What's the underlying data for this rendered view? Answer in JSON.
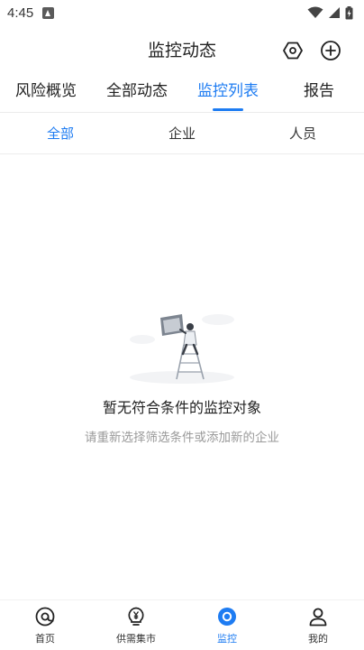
{
  "status_bar": {
    "time": "4:45"
  },
  "header": {
    "title": "监控动态"
  },
  "main_tabs": [
    {
      "label": "风险概览"
    },
    {
      "label": "全部动态"
    },
    {
      "label": "监控列表"
    },
    {
      "label": "报告"
    }
  ],
  "active_main_tab": "监控列表",
  "sub_tabs": [
    {
      "label": "全部"
    },
    {
      "label": "企业"
    },
    {
      "label": "人员"
    }
  ],
  "active_sub_tab": "全部",
  "empty_state": {
    "title": "暂无符合条件的监控对象",
    "subtitle": "请重新选择筛选条件或添加新的企业"
  },
  "bottom_nav": [
    {
      "label": "首页",
      "icon": "home-at-icon"
    },
    {
      "label": "供需集市",
      "icon": "yen-bulb-icon"
    },
    {
      "label": "监控",
      "icon": "monitor-eye-icon"
    },
    {
      "label": "我的",
      "icon": "user-icon"
    }
  ],
  "active_bottom_nav": "监控",
  "colors": {
    "accent": "#1e7cf2",
    "text": "#222222",
    "muted": "#9a9a9a"
  }
}
